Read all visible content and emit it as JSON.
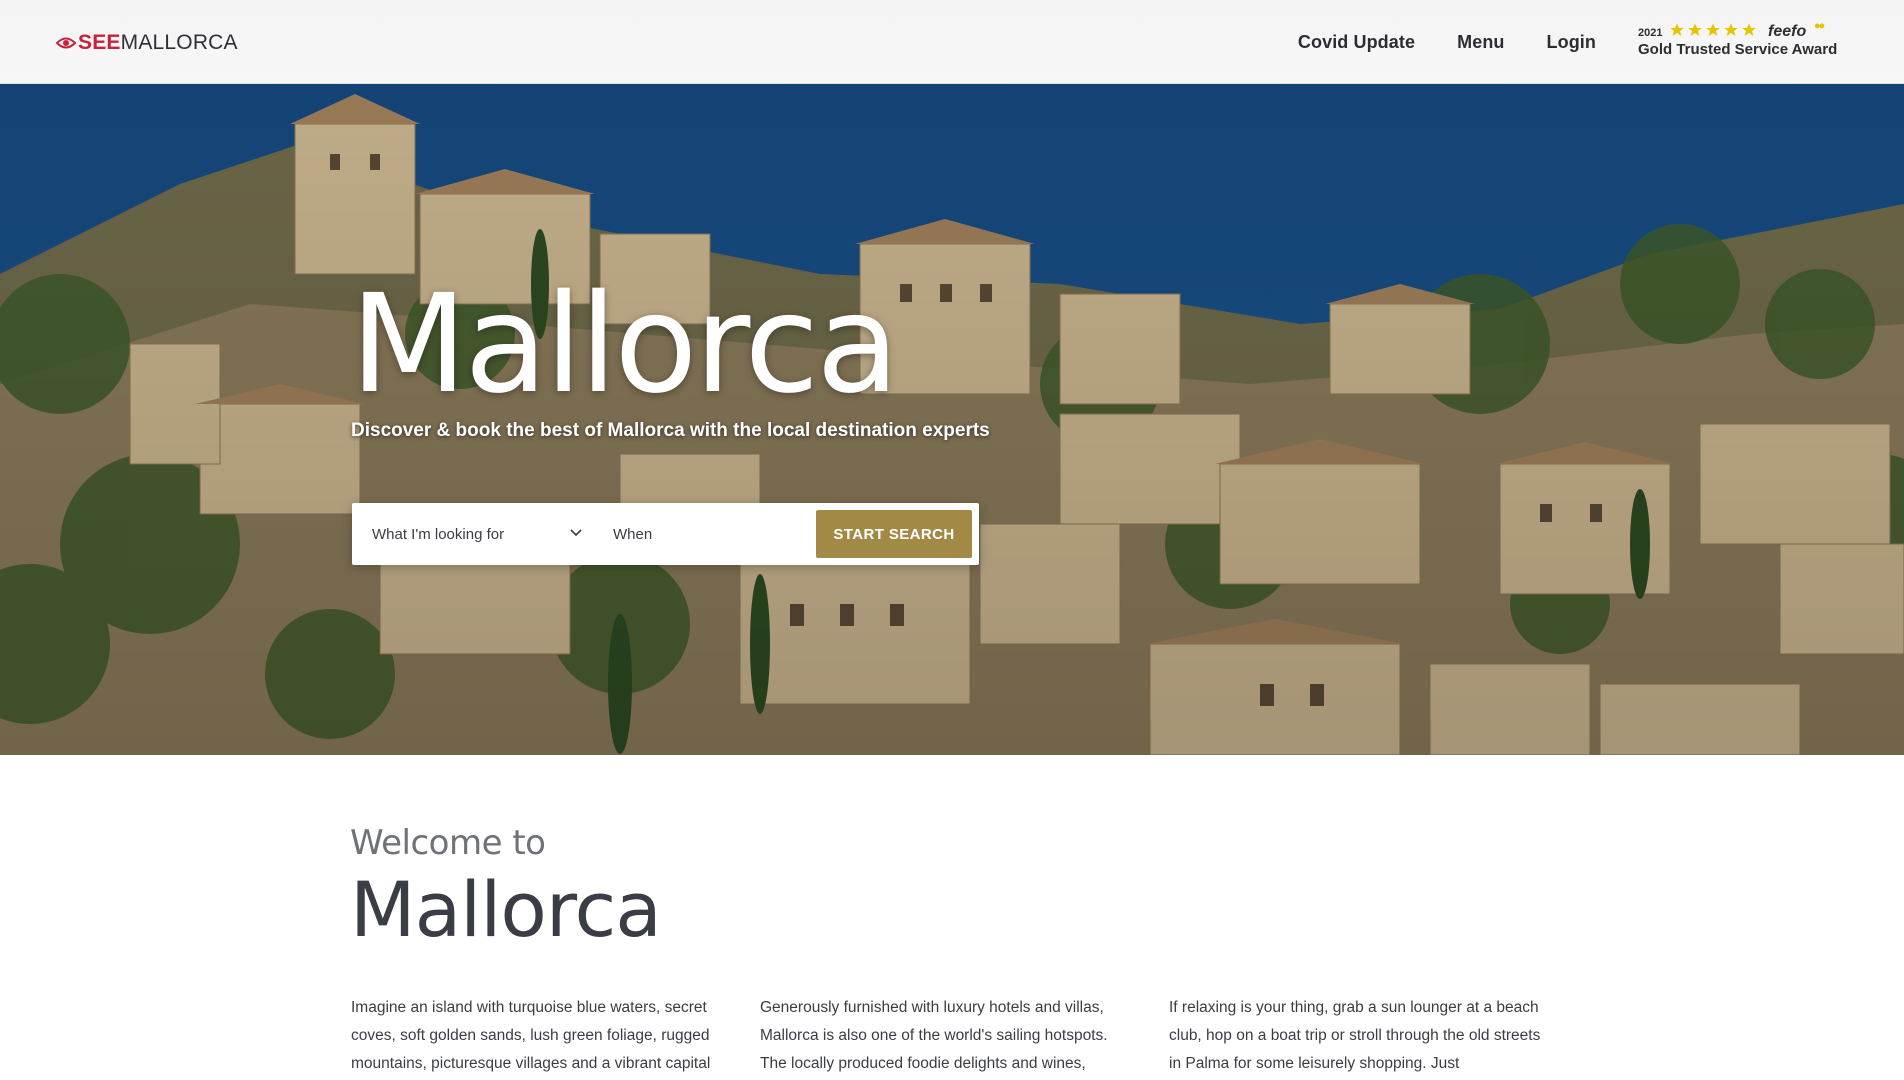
{
  "header": {
    "logo": {
      "part1": "SEE",
      "part2": "MALLORCA",
      "icon": "eye-icon"
    },
    "nav": [
      {
        "label": "Covid Update"
      },
      {
        "label": "Menu"
      },
      {
        "label": "Login"
      }
    ],
    "award": {
      "year": "2021",
      "stars": 5,
      "brand": "feefo",
      "text": "Gold Trusted Service Award",
      "star_color": "#e6c500"
    }
  },
  "hero": {
    "title": "Mallorca",
    "subtitle": "Discover & book the best of Mallorca with the local destination experts",
    "search": {
      "select_label": "What I'm looking for",
      "when_placeholder": "When",
      "button_label": "START SEARCH"
    }
  },
  "welcome": {
    "pretitle": "Welcome to",
    "title": "Mallorca",
    "columns": [
      "Imagine an island with turquoise blue waters, secret coves, soft golden sands, lush green foliage, rugged mountains, picturesque villages and a vibrant capital",
      "Generously furnished with luxury hotels and villas, Mallorca is also one of the world's sailing hotspots. The locally produced foodie delights and wines,",
      "If relaxing is your thing, grab a sun lounger at a beach club, hop on a boat trip or stroll through the old streets in Palma for some leisurely shopping. Just"
    ]
  },
  "colors": {
    "brand_red": "#c8203d",
    "accent_gold": "#a28a46",
    "text_dark": "#3a3d45"
  }
}
